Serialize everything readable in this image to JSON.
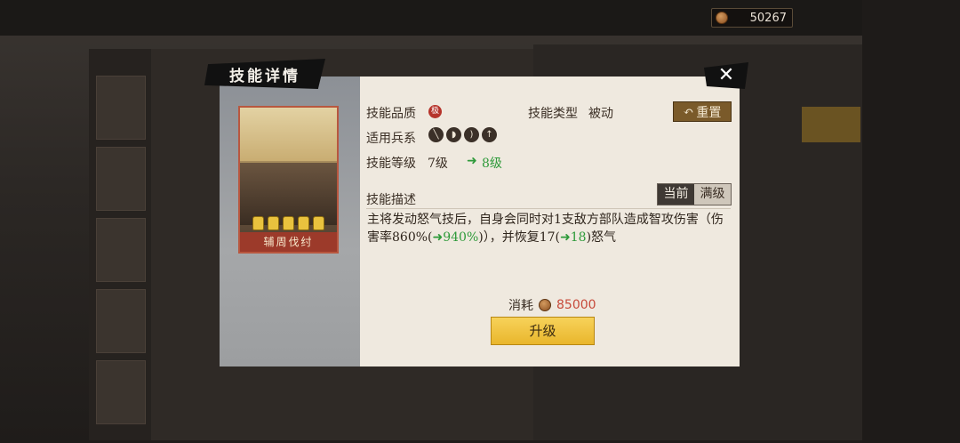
{
  "currency": {
    "amount": "50267"
  },
  "dialog": {
    "title": "技能详情",
    "close_icon": "close-icon"
  },
  "skill_card": {
    "name": "辅周伐纣",
    "stars": 5
  },
  "info": {
    "quality_label": "技能品质",
    "quality_badge": "极",
    "type_label": "技能类型",
    "type_value": "被动",
    "troops_label": "适用兵系",
    "troop_icons": [
      "spear-icon",
      "shield-icon",
      "bow-icon",
      "halberd-icon"
    ],
    "level_label": "技能等级",
    "level_current": "7级",
    "level_next": "8级",
    "reset_label": "重置"
  },
  "description": {
    "label": "技能描述",
    "tab_current": "当前",
    "tab_max": "满级",
    "text_a": "主将发动怒气技后，自身会同时对1支敌方部队造成智攻伤害（伤害率860%(",
    "text_b": "➜940%",
    "text_c": ")），并恢复17(",
    "text_d": "➜18",
    "text_e": ")怒气"
  },
  "upgrade": {
    "cost_label": "消耗",
    "cost_value": "85000",
    "button_label": "升级"
  }
}
